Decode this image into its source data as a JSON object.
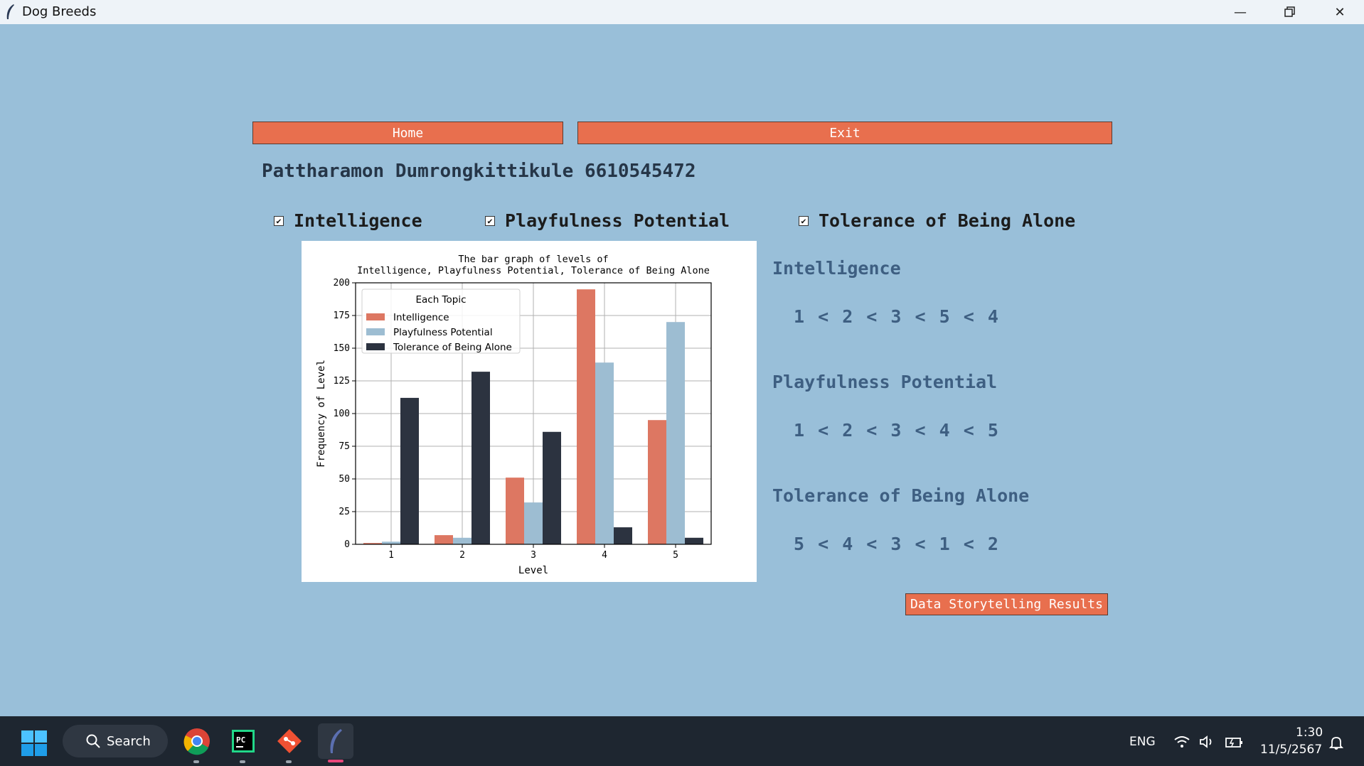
{
  "window": {
    "title": "Dog Breeds"
  },
  "buttons": {
    "home": "Home",
    "exit": "Exit",
    "storytelling": "Data Storytelling Results"
  },
  "author": "Pattharamon Dumrongkittikule 6610545472",
  "checkboxes": [
    {
      "label": "Intelligence",
      "checked": true
    },
    {
      "label": "Playfulness Potential",
      "checked": true
    },
    {
      "label": "Tolerance of Being Alone",
      "checked": true
    }
  ],
  "rankings": [
    {
      "topic": "Intelligence",
      "order": "1 < 2 < 3 < 5 < 4"
    },
    {
      "topic": "Playfulness Potential",
      "order": "1 < 2 < 3 < 4 < 5"
    },
    {
      "topic": "Tolerance of Being Alone",
      "order": "5 < 4 < 3 < 1 < 2"
    }
  ],
  "chart_data": {
    "type": "bar",
    "title": "The bar graph of levels of\nIntelligence, Playfulness Potential, Tolerance of Being Alone",
    "xlabel": "Level",
    "ylabel": "Frequency of Level",
    "categories": [
      "1",
      "2",
      "3",
      "4",
      "5"
    ],
    "ylim": [
      0,
      200
    ],
    "yticks": [
      0,
      25,
      50,
      75,
      100,
      125,
      150,
      175,
      200
    ],
    "grid": true,
    "legend": {
      "title": "Each Topic",
      "position": "upper-left"
    },
    "series": [
      {
        "name": "Intelligence",
        "color": "#dd7762",
        "values": [
          1,
          7,
          51,
          195,
          95
        ]
      },
      {
        "name": "Playfulness Potential",
        "color": "#9dbdd2",
        "values": [
          2,
          5,
          32,
          139,
          170
        ]
      },
      {
        "name": "Tolerance of Being Alone",
        "color": "#2c3340",
        "values": [
          112,
          132,
          86,
          13,
          5
        ]
      }
    ]
  },
  "taskbar": {
    "search": "Search",
    "lang": "ENG",
    "time": "1:30",
    "date": "11/5/2567",
    "apps": [
      "chrome-icon",
      "pycharm-icon",
      "git-icon",
      "feather-icon"
    ]
  },
  "colors": {
    "background": "#99bfd9",
    "button": "#e86f4e",
    "heading": "#3e5f82"
  }
}
